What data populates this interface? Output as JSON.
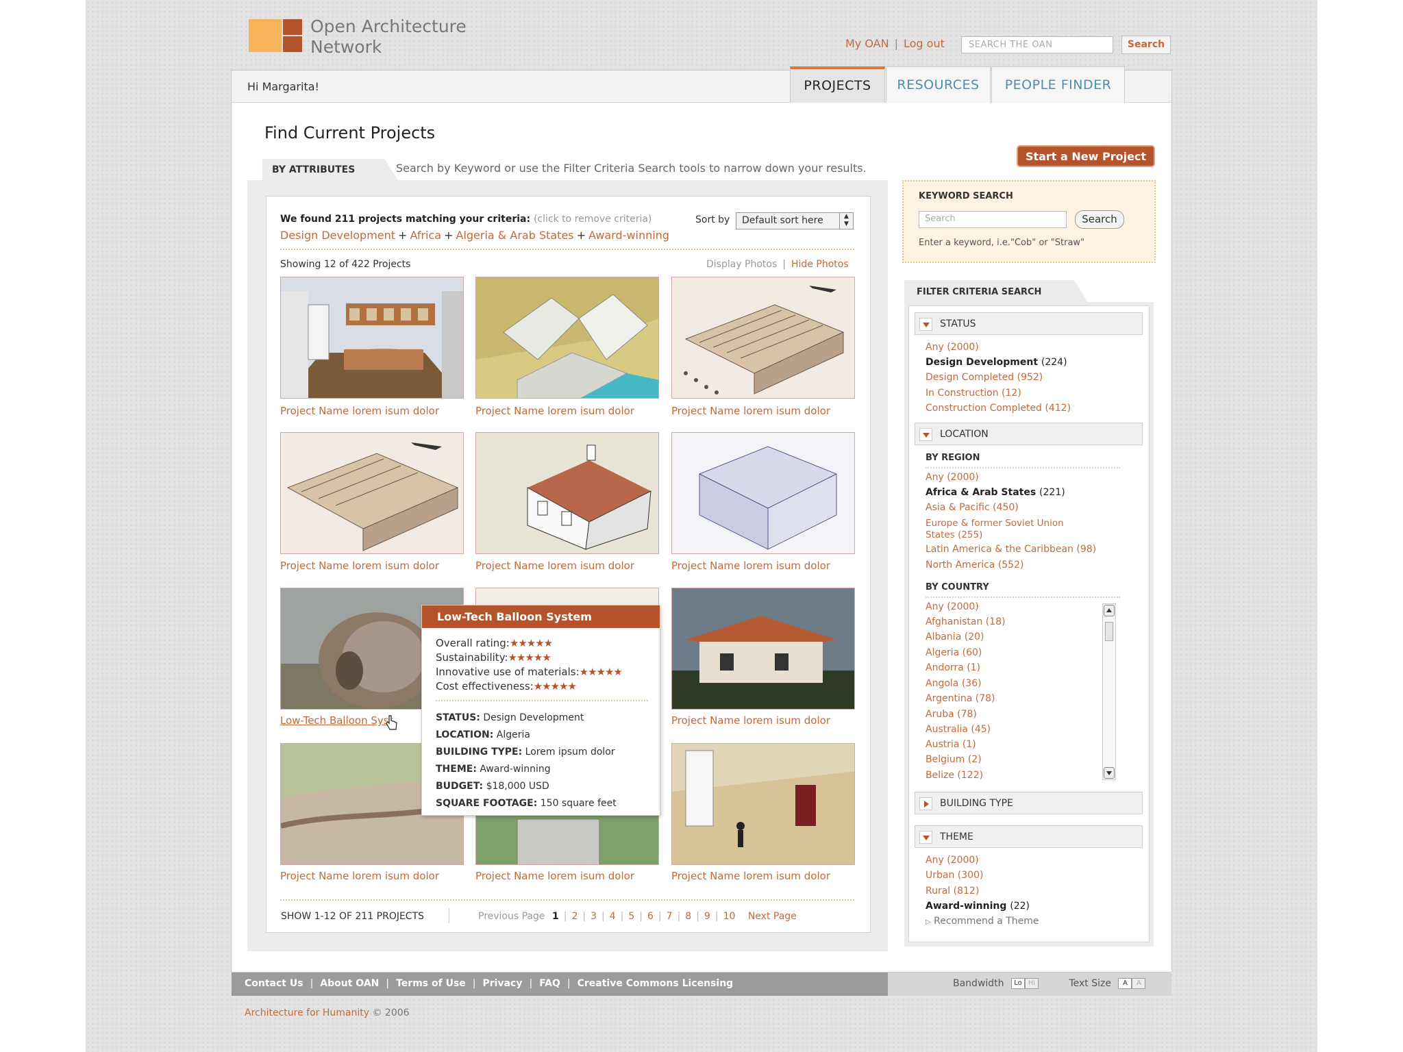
{
  "brand": {
    "line1": "Open Architecture",
    "line2": "Network"
  },
  "header": {
    "my_oan": "My OAN",
    "separator": "|",
    "logout": "Log out",
    "search_placeholder": "SEARCH THE OAN",
    "search_button": "Search"
  },
  "greeting": "Hi Margarita!",
  "tabs": {
    "projects": "PROJECTS",
    "resources": "RESOURCES",
    "people_finder": "PEOPLE FINDER"
  },
  "page_title": "Find Current Projects",
  "start_project": "Start a New Project",
  "attr_tab": "BY ATTRIBUTES",
  "attr_desc": "Search by Keyword or use the Filter Criteria Search tools to narrow down your results.",
  "results": {
    "found": "We found 211 projects matching your criteria:",
    "remove_hint": "(click to remove criteria)",
    "criteria": [
      "Design Development",
      "Africa",
      "Algeria & Arab States",
      "Award-winning"
    ],
    "plus": "+",
    "sort_label": "Sort by",
    "sort_value": "Default sort here",
    "showing": "Showing 12 of 422  Projects",
    "display_photos": "Display Photos",
    "hide_photos": "Hide Photos",
    "photo_sep": "|",
    "captions": [
      "Project Name lorem isum dolor",
      "Project Name lorem isum dolor",
      "Project Name lorem isum dolor",
      "Project Name lorem isum dolor",
      "Project Name lorem isum dolor",
      "Project Name lorem isum dolor",
      "Low-Tech Balloon Syst",
      "Project Name lorem isum dolor",
      "Project Name lorem isum dolor",
      "Project Name lorem isum dolor",
      "Project Name lorem isum dolor"
    ]
  },
  "pager": {
    "label": "SHOW 1-12 OF 211 PROJECTS",
    "prev": "Previous Page",
    "pages": [
      "1",
      "2",
      "3",
      "4",
      "5",
      "6",
      "7",
      "8",
      "9",
      "10"
    ],
    "sep": "|",
    "next": "Next Page"
  },
  "popup": {
    "title": "Low-Tech Balloon System",
    "ratings": [
      {
        "label": "Overall rating:",
        "stars": "★★★★★"
      },
      {
        "label": "Sustainability:",
        "stars": "★★★★★"
      },
      {
        "label": "Innovative use of materials:",
        "stars": "★★★★★"
      },
      {
        "label": "Cost effectiveness:",
        "stars": "★★★★★"
      }
    ],
    "details": [
      {
        "label": "STATUS:",
        "value": "Design Development"
      },
      {
        "label": "LOCATION:",
        "value": "Algeria"
      },
      {
        "label": "BUILDING TYPE:",
        "value": "Lorem ipsum dolor"
      },
      {
        "label": "THEME:",
        "value": "Award-winning"
      },
      {
        "label": "BUDGET:",
        "value": "$18,000 USD"
      },
      {
        "label": "SQUARE FOOTAGE:",
        "value": "150 square feet"
      }
    ]
  },
  "keyword_search": {
    "title": "KEYWORD SEARCH",
    "placeholder": "Search",
    "button": "Search",
    "hint": "Enter a keyword, i.e.\"Cob\" or \"Straw\""
  },
  "filter": {
    "tab": "FILTER CRITERIA SEARCH",
    "status": {
      "label": "STATUS",
      "options": [
        {
          "name": "Any",
          "count": "(2000)"
        },
        {
          "name": "Design Development",
          "count": "(224)"
        },
        {
          "name": "Design Completed",
          "count": "(952)"
        },
        {
          "name": "In Construction",
          "count": "(12)"
        },
        {
          "name": "Construction Completed",
          "count": "(412)"
        }
      ]
    },
    "location": {
      "label": "LOCATION",
      "by_region": "BY REGION",
      "regions": [
        {
          "name": "Any",
          "count": "(2000)"
        },
        {
          "name": "Africa & Arab States",
          "count": "(221)"
        },
        {
          "name": "Asia & Pacific",
          "count": "(450)"
        },
        {
          "name": "Europe & former Soviet Union",
          "name2": "States",
          "count": "(255)"
        },
        {
          "name": "Latin America & the Caribbean",
          "count": "(98)"
        },
        {
          "name": "North America",
          "count": "(552)"
        }
      ],
      "by_country": "BY COUNTRY",
      "countries": [
        {
          "name": "Any",
          "count": "(2000)"
        },
        {
          "name": "Afghanistan",
          "count": "(18)"
        },
        {
          "name": "Albania",
          "count": "(20)"
        },
        {
          "name": "Algeria",
          "count": "(60)"
        },
        {
          "name": "Andorra",
          "count": "(1)"
        },
        {
          "name": "Angola",
          "count": "(36)"
        },
        {
          "name": "Argentina",
          "count": "(78)"
        },
        {
          "name": "Aruba",
          "count": "(78)"
        },
        {
          "name": "Australia",
          "count": "(45)"
        },
        {
          "name": "Austria",
          "count": "(1)"
        },
        {
          "name": "Belgium",
          "count": "(2)"
        },
        {
          "name": "Belize",
          "count": "(122)"
        }
      ]
    },
    "building_type": {
      "label": "BUILDING TYPE"
    },
    "theme": {
      "label": "THEME",
      "options": [
        {
          "name": "Any",
          "count": "(2000)"
        },
        {
          "name": "Urban",
          "count": "(300)"
        },
        {
          "name": "Rural",
          "count": "(812)"
        },
        {
          "name": "Award-winning",
          "count": "(22)"
        }
      ],
      "recommend": "Recommend a Theme"
    }
  },
  "footer": {
    "links": [
      "Contact Us",
      "About OAN",
      "Terms of Use",
      "Privacy",
      "FAQ",
      "Creative Commons Licensing"
    ],
    "sep": "|",
    "bandwidth": "Bandwidth",
    "bw_lo": "Lo",
    "bw_hi": "Hi",
    "text_size": "Text Size",
    "ts_a1": "A",
    "ts_a2": "A",
    "copyright_org": "Architecture for Humanity",
    "copyright_year": "© 2006"
  },
  "colors": {
    "accent": "#b4542c",
    "link": "#c26a3a",
    "tab_blue": "#4d8fa9"
  }
}
